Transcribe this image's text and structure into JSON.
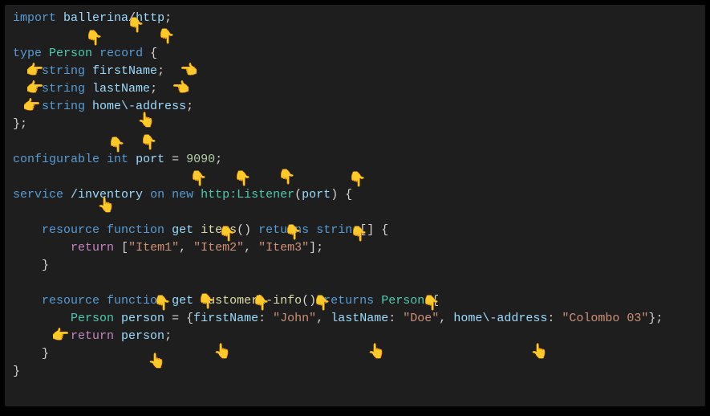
{
  "code": {
    "l1": {
      "import": "import",
      "module": "ballerina",
      "slash": "/",
      "sub": "http",
      "semi": ";"
    },
    "l3": {
      "type": "type",
      "name": "Person",
      "record": "record",
      "open": "{"
    },
    "l4": {
      "dtype": "string",
      "field": "firstName",
      "semi": ";"
    },
    "l5": {
      "dtype": "string",
      "field": "lastName",
      "semi": ";"
    },
    "l6": {
      "dtype": "string",
      "field": "home\\-address",
      "semi": ";"
    },
    "l7": {
      "close": "};"
    },
    "l9": {
      "configurable": "configurable",
      "int": "int",
      "name": "port",
      "eq": "=",
      "val": "9090",
      "semi": ";"
    },
    "l11": {
      "service": "service",
      "path": "/inventory",
      "on": "on",
      "new": "new",
      "listener": "http:Listener",
      "lp": "(",
      "arg": "port",
      "rp": ")",
      "open": "{"
    },
    "l13": {
      "resource": "resource",
      "function": "function",
      "method": "get",
      "name": "items",
      "parens": "()",
      "returns": "returns",
      "rtype": "string",
      "arr": "[]",
      "open": "{"
    },
    "l14": {
      "return": "return",
      "lb": "[",
      "s1": "\"Item1\"",
      "c1": ",",
      "s2": "\"Item2\"",
      "c2": ",",
      "s3": "\"Item3\"",
      "rb": "];"
    },
    "l15": {
      "close": "}"
    },
    "l17": {
      "resource": "resource",
      "function": "function",
      "method": "get",
      "name": "customer\\-info",
      "parens": "()",
      "returns": "returns",
      "rtype": "Person",
      "open": "{"
    },
    "l18": {
      "type": "Person",
      "var": "person",
      "eq": "=",
      "lb": "{",
      "k1": "firstName",
      "c1": ":",
      "v1": "\"John\"",
      "cm1": ",",
      "k2": "lastName",
      "c2": ":",
      "v2": "\"Doe\"",
      "cm2": ",",
      "k3": "home\\-address",
      "c3": ":",
      "v3": "\"Colombo 03\"",
      "rb": "};"
    },
    "l19": {
      "return": "return",
      "var": "person",
      "semi": ";"
    },
    "l20": {
      "close": "}"
    },
    "l21": {
      "close": "}"
    }
  },
  "pointers": {
    "down": "👇",
    "right": "👉",
    "left": "👈",
    "up": "👆"
  }
}
